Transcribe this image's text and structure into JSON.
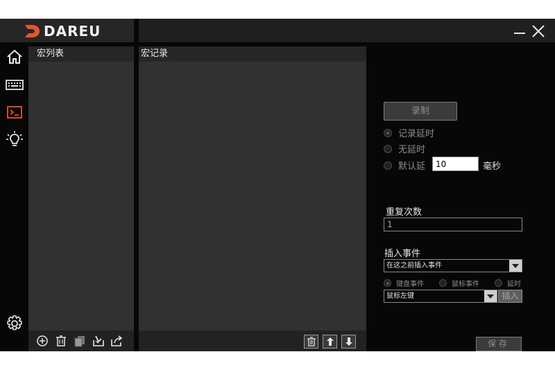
{
  "app": {
    "brand": "DAREU"
  },
  "colors": {
    "accent": "#e8552a",
    "panel": "#313131",
    "panel_header": "#262626",
    "background": "#070707"
  },
  "nav": {
    "items": [
      {
        "icon": "home-icon"
      },
      {
        "icon": "keyboard-icon"
      },
      {
        "icon": "macro-icon",
        "active": true
      },
      {
        "icon": "lightbulb-icon"
      },
      {
        "icon": "settings-gear-icon"
      }
    ]
  },
  "macro_list": {
    "title": "宏列表",
    "toolbar": [
      "add-icon",
      "delete-icon",
      "copy-icon",
      "import-icon",
      "export-icon"
    ]
  },
  "macro_record": {
    "title": "宏记录",
    "toolbar": [
      "delete-icon",
      "move-up-icon",
      "move-down-icon"
    ]
  },
  "settings": {
    "record_button": "录制",
    "delay_options": [
      {
        "label": "记录延时",
        "checked": true
      },
      {
        "label": "无延时",
        "checked": false
      },
      {
        "label": "默认延",
        "checked": false
      }
    ],
    "default_delay_value": "10",
    "delay_unit": "毫秒",
    "repeat_label": "重复次数",
    "repeat_value": "1",
    "insert_label": "插入事件",
    "insert_position": "在这之前插入事件",
    "event_types": [
      {
        "label": "键盘事件",
        "checked": true
      },
      {
        "label": "鼠标事件",
        "checked": false
      },
      {
        "label": "延时",
        "checked": false
      }
    ],
    "mouse_key": "鼠标左键",
    "insert_button": "插入",
    "save_button": "保存"
  }
}
